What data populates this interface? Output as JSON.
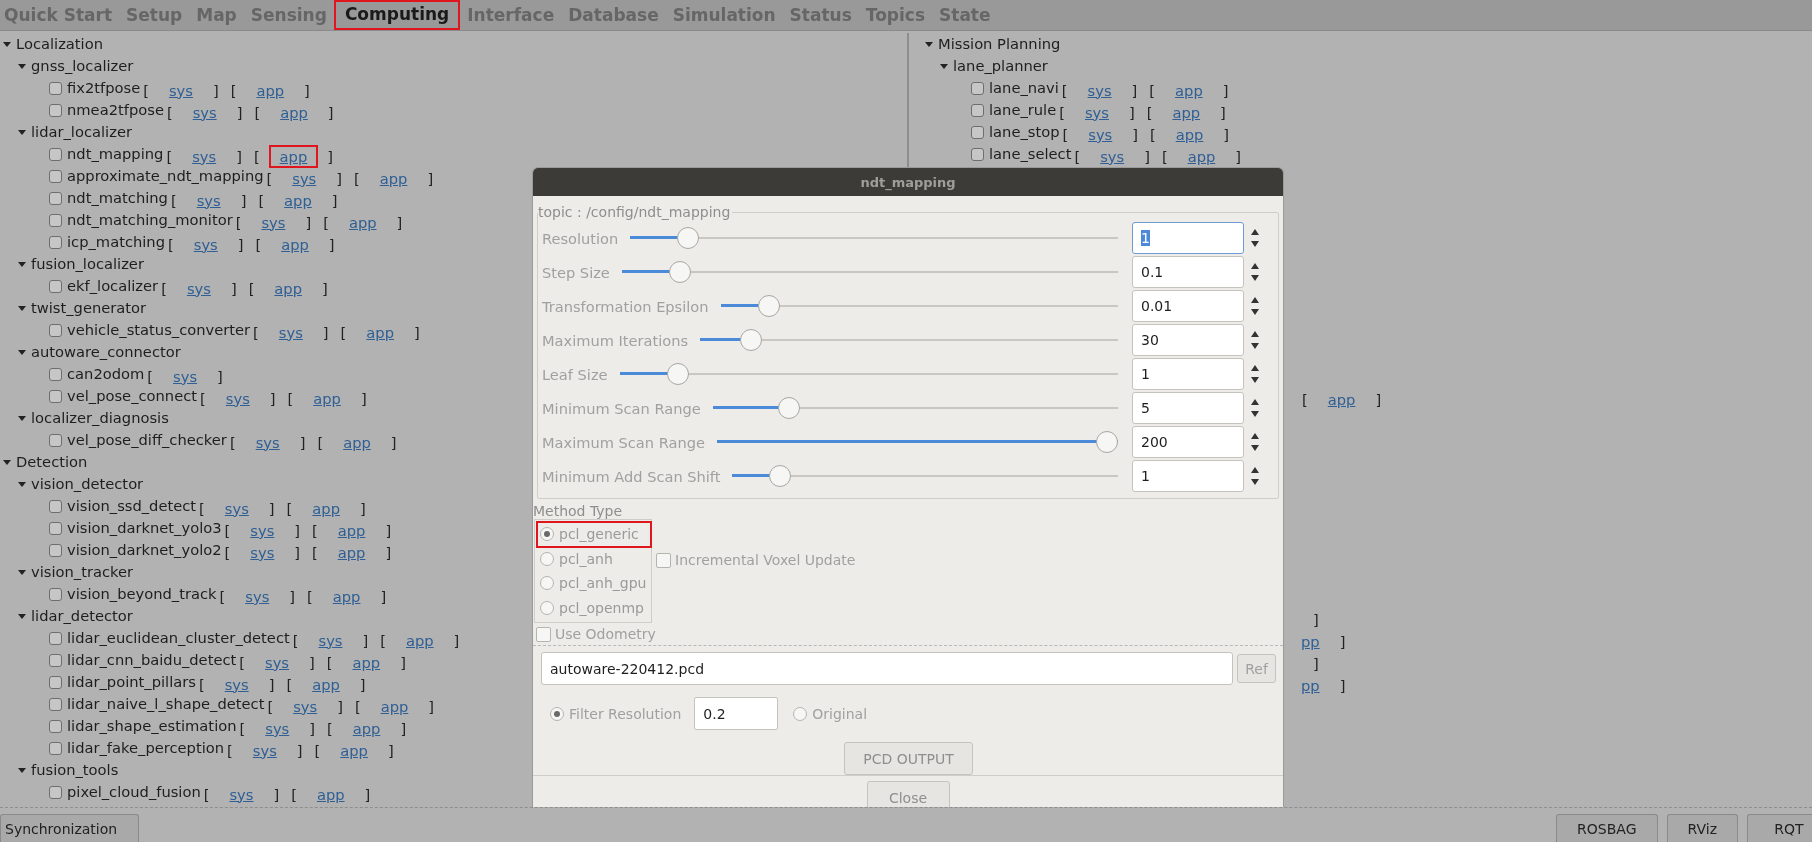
{
  "tabs": [
    {
      "label": "Quick Start",
      "selected": false,
      "highlighted": false
    },
    {
      "label": "Setup",
      "selected": false,
      "highlighted": false
    },
    {
      "label": "Map",
      "selected": false,
      "highlighted": false
    },
    {
      "label": "Sensing",
      "selected": false,
      "highlighted": false
    },
    {
      "label": "Computing",
      "selected": true,
      "highlighted": true
    },
    {
      "label": "Interface",
      "selected": false,
      "highlighted": false
    },
    {
      "label": "Database",
      "selected": false,
      "highlighted": false
    },
    {
      "label": "Simulation",
      "selected": false,
      "highlighted": false
    },
    {
      "label": "Status",
      "selected": false,
      "highlighted": false
    },
    {
      "label": "Topics",
      "selected": false,
      "highlighted": false
    },
    {
      "label": "State",
      "selected": false,
      "highlighted": false
    }
  ],
  "left_tree": [
    {
      "label": "Localization",
      "expanded": true,
      "children": [
        {
          "label": "gnss_localizer",
          "expanded": true,
          "children": [
            {
              "label": "fix2tfpose",
              "checked": false,
              "links": [
                {
                  "open": "[",
                  "text": "sys",
                  "close": "]",
                  "highlighted": false
                },
                {
                  "open": "[",
                  "text": "app",
                  "close": "]",
                  "highlighted": false
                }
              ]
            },
            {
              "label": "nmea2tfpose",
              "checked": false,
              "links": [
                {
                  "open": "[",
                  "text": "sys",
                  "close": "]",
                  "highlighted": false
                },
                {
                  "open": "[",
                  "text": "app",
                  "close": "]",
                  "highlighted": false
                }
              ]
            }
          ]
        },
        {
          "label": "lidar_localizer",
          "expanded": true,
          "children": [
            {
              "label": "ndt_mapping",
              "checked": false,
              "links": [
                {
                  "open": "[",
                  "text": "sys",
                  "close": "]",
                  "highlighted": false
                },
                {
                  "open": "[",
                  "text": "app",
                  "close": "]",
                  "highlighted": true
                }
              ]
            },
            {
              "label": "approximate_ndt_mapping",
              "checked": false,
              "links": [
                {
                  "open": "[",
                  "text": "sys",
                  "close": "]",
                  "highlighted": false
                },
                {
                  "open": "[",
                  "text": "app",
                  "close": "]",
                  "highlighted": false
                }
              ]
            },
            {
              "label": "ndt_matching",
              "checked": false,
              "links": [
                {
                  "open": "[",
                  "text": "sys",
                  "close": "]",
                  "highlighted": false
                },
                {
                  "open": "[",
                  "text": "app",
                  "close": "]",
                  "highlighted": false
                }
              ]
            },
            {
              "label": "ndt_matching_monitor",
              "checked": false,
              "links": [
                {
                  "open": "[",
                  "text": "sys",
                  "close": "]",
                  "highlighted": false
                },
                {
                  "open": "[",
                  "text": "app",
                  "close": "]",
                  "highlighted": false
                }
              ]
            },
            {
              "label": "icp_matching",
              "checked": false,
              "links": [
                {
                  "open": "[",
                  "text": "sys",
                  "close": "]",
                  "highlighted": false
                },
                {
                  "open": "[",
                  "text": "app",
                  "close": "]",
                  "highlighted": false
                }
              ]
            }
          ]
        },
        {
          "label": "fusion_localizer",
          "expanded": true,
          "children": [
            {
              "label": "ekf_localizer",
              "checked": false,
              "links": [
                {
                  "open": "[",
                  "text": "sys",
                  "close": "]",
                  "highlighted": false
                },
                {
                  "open": "[",
                  "text": "app",
                  "close": "]",
                  "highlighted": false
                }
              ]
            }
          ]
        },
        {
          "label": "twist_generator",
          "expanded": true,
          "children": [
            {
              "label": "vehicle_status_converter",
              "checked": false,
              "links": [
                {
                  "open": "[",
                  "text": "sys",
                  "close": "]",
                  "highlighted": false
                },
                {
                  "open": "[",
                  "text": "app",
                  "close": "]",
                  "highlighted": false
                }
              ]
            }
          ]
        },
        {
          "label": "autoware_connector",
          "expanded": true,
          "children": [
            {
              "label": "can2odom",
              "checked": false,
              "links": [
                {
                  "open": "[",
                  "text": "sys",
                  "close": "]",
                  "highlighted": false
                }
              ]
            },
            {
              "label": "vel_pose_connect",
              "checked": false,
              "links": [
                {
                  "open": "[",
                  "text": "sys",
                  "close": "]",
                  "highlighted": false
                },
                {
                  "open": "[",
                  "text": "app",
                  "close": "]",
                  "highlighted": false
                }
              ]
            }
          ]
        },
        {
          "label": "localizer_diagnosis",
          "expanded": true,
          "children": [
            {
              "label": "vel_pose_diff_checker",
              "checked": false,
              "links": [
                {
                  "open": "[",
                  "text": "sys",
                  "close": "]",
                  "highlighted": false
                },
                {
                  "open": "[",
                  "text": "app",
                  "close": "]",
                  "highlighted": false
                }
              ]
            }
          ]
        }
      ]
    },
    {
      "label": "Detection",
      "expanded": true,
      "children": [
        {
          "label": "vision_detector",
          "expanded": true,
          "children": [
            {
              "label": "vision_ssd_detect",
              "checked": false,
              "links": [
                {
                  "open": "[",
                  "text": "sys",
                  "close": "]",
                  "highlighted": false
                },
                {
                  "open": "[",
                  "text": "app",
                  "close": "]",
                  "highlighted": false
                }
              ]
            },
            {
              "label": "vision_darknet_yolo3",
              "checked": false,
              "links": [
                {
                  "open": "[",
                  "text": "sys",
                  "close": "]",
                  "highlighted": false
                },
                {
                  "open": "[",
                  "text": "app",
                  "close": "]",
                  "highlighted": false
                }
              ]
            },
            {
              "label": "vision_darknet_yolo2",
              "checked": false,
              "links": [
                {
                  "open": "[",
                  "text": "sys",
                  "close": "]",
                  "highlighted": false
                },
                {
                  "open": "[",
                  "text": "app",
                  "close": "]",
                  "highlighted": false
                }
              ]
            }
          ]
        },
        {
          "label": "vision_tracker",
          "expanded": true,
          "children": [
            {
              "label": "vision_beyond_track",
              "checked": false,
              "links": [
                {
                  "open": "[",
                  "text": "sys",
                  "close": "]",
                  "highlighted": false
                },
                {
                  "open": "[",
                  "text": "app",
                  "close": "]",
                  "highlighted": false
                }
              ]
            }
          ]
        },
        {
          "label": "lidar_detector",
          "expanded": true,
          "children": [
            {
              "label": "lidar_euclidean_cluster_detect",
              "checked": false,
              "links": [
                {
                  "open": "[",
                  "text": "sys",
                  "close": "]",
                  "highlighted": false
                },
                {
                  "open": "[",
                  "text": "app",
                  "close": "]",
                  "highlighted": false
                }
              ]
            },
            {
              "label": "lidar_cnn_baidu_detect",
              "checked": false,
              "links": [
                {
                  "open": "[",
                  "text": "sys",
                  "close": "]",
                  "highlighted": false
                },
                {
                  "open": "[",
                  "text": "app",
                  "close": "]",
                  "highlighted": false
                }
              ]
            },
            {
              "label": "lidar_point_pillars",
              "checked": false,
              "links": [
                {
                  "open": "[",
                  "text": "sys",
                  "close": "]",
                  "highlighted": false
                },
                {
                  "open": "[",
                  "text": "app",
                  "close": "]",
                  "highlighted": false
                }
              ]
            },
            {
              "label": "lidar_naive_l_shape_detect",
              "checked": false,
              "links": [
                {
                  "open": "[",
                  "text": "sys",
                  "close": "]",
                  "highlighted": false
                },
                {
                  "open": "[",
                  "text": "app",
                  "close": "]",
                  "highlighted": false
                }
              ]
            },
            {
              "label": "lidar_shape_estimation",
              "checked": false,
              "links": [
                {
                  "open": "[",
                  "text": "sys",
                  "close": "]",
                  "highlighted": false
                },
                {
                  "open": "[",
                  "text": "app",
                  "close": "]",
                  "highlighted": false
                }
              ]
            },
            {
              "label": "lidar_fake_perception",
              "checked": false,
              "links": [
                {
                  "open": "[",
                  "text": "sys",
                  "close": "]",
                  "highlighted": false
                },
                {
                  "open": "[",
                  "text": "app",
                  "close": "]",
                  "highlighted": false
                }
              ]
            }
          ]
        },
        {
          "label": "fusion_tools",
          "expanded": true,
          "children": [
            {
              "label": "pixel_cloud_fusion",
              "checked": false,
              "links": [
                {
                  "open": "[",
                  "text": "sys",
                  "close": "]",
                  "highlighted": false
                },
                {
                  "open": "[",
                  "text": "app",
                  "close": "]",
                  "highlighted": false
                }
              ]
            }
          ]
        }
      ]
    }
  ],
  "right_tree": [
    {
      "label": "Mission Planning",
      "expanded": true,
      "children": [
        {
          "label": "lane_planner",
          "expanded": true,
          "children": [
            {
              "label": "lane_navi",
              "checked": false,
              "links": [
                {
                  "open": "[",
                  "text": "sys",
                  "close": "]",
                  "highlighted": false
                },
                {
                  "open": "[",
                  "text": "app",
                  "close": "]",
                  "highlighted": false
                }
              ]
            },
            {
              "label": "lane_rule",
              "checked": false,
              "links": [
                {
                  "open": "[",
                  "text": "sys",
                  "close": "]",
                  "highlighted": false
                },
                {
                  "open": "[",
                  "text": "app",
                  "close": "]",
                  "highlighted": false
                }
              ]
            },
            {
              "label": "lane_stop",
              "checked": false,
              "links": [
                {
                  "open": "[",
                  "text": "sys",
                  "close": "]",
                  "highlighted": false
                },
                {
                  "open": "[",
                  "text": "app",
                  "close": "]",
                  "highlighted": false
                }
              ]
            },
            {
              "label": "lane_select",
              "checked": false,
              "links": [
                {
                  "open": "[",
                  "text": "sys",
                  "close": "]",
                  "highlighted": false
                },
                {
                  "open": "[",
                  "text": "app",
                  "close": "]",
                  "highlighted": false
                }
              ]
            }
          ]
        }
      ]
    }
  ],
  "right_covered_rows": [
    {
      "parts": [
        {
          "kind": "bracket",
          "text": "["
        },
        {
          "kind": "link",
          "text": "app"
        },
        {
          "kind": "bracket",
          "text": "]"
        }
      ]
    },
    {
      "parts": [
        {
          "kind": "bracket",
          "text": "]"
        }
      ]
    },
    {
      "parts": [
        {
          "kind": "link",
          "text": "pp"
        },
        {
          "kind": "bracket",
          "text": "]"
        }
      ]
    },
    {
      "parts": [
        {
          "kind": "bracket",
          "text": "]"
        }
      ]
    },
    {
      "parts": [
        {
          "kind": "link",
          "text": "pp"
        },
        {
          "kind": "bracket",
          "text": "]"
        }
      ]
    }
  ],
  "dialog": {
    "title": "ndt_mapping",
    "topic": "topic : /config/ndt_mapping",
    "params": [
      {
        "label": "Resolution",
        "level": 0.1,
        "value": "1",
        "focused": true
      },
      {
        "label": "Step Size",
        "level": 0.1,
        "value": "0.1",
        "focused": false
      },
      {
        "label": "Transformation Epsilon",
        "level": 0.1,
        "value": "0.01",
        "focused": false
      },
      {
        "label": "Maximum Iterations",
        "level": 0.1,
        "value": "30",
        "focused": false
      },
      {
        "label": "Leaf Size",
        "level": 0.1,
        "value": "1",
        "focused": false
      },
      {
        "label": "Minimum Scan Range",
        "level": 0.17,
        "value": "5",
        "focused": false
      },
      {
        "label": "Maximum Scan Range",
        "level": 1,
        "value": "200",
        "focused": false
      },
      {
        "label": "Minimum Add Scan Shift",
        "level": 0.1,
        "value": "1",
        "focused": false
      }
    ],
    "method_type": {
      "label": "Method Type",
      "options": [
        {
          "label": "pcl_generic",
          "selected": true,
          "highlighted": true
        },
        {
          "label": "pcl_anh",
          "selected": false,
          "highlighted": false
        },
        {
          "label": "pcl_anh_gpu",
          "selected": false,
          "highlighted": false
        },
        {
          "label": "pcl_openmp",
          "selected": false,
          "highlighted": false
        }
      ]
    },
    "incremental_voxel_update": {
      "label": "Incremental Voxel Update",
      "checked": false
    },
    "use_odometry": {
      "label": "Use Odometry",
      "checked": false
    },
    "file": {
      "value": "autoware-220412.pcd"
    },
    "ref_button": "Ref",
    "filter_options": [
      {
        "label": "Filter Resolution",
        "selected": true,
        "value": "0.2"
      },
      {
        "label": "Original",
        "selected": false
      }
    ],
    "pcd_output_button": "PCD OUTPUT",
    "close_button": "Close"
  },
  "bottom_left_buttons": [
    "Synchronization"
  ],
  "bottom_right_buttons": [
    "ROSBAG",
    "RViz",
    "RQT"
  ]
}
